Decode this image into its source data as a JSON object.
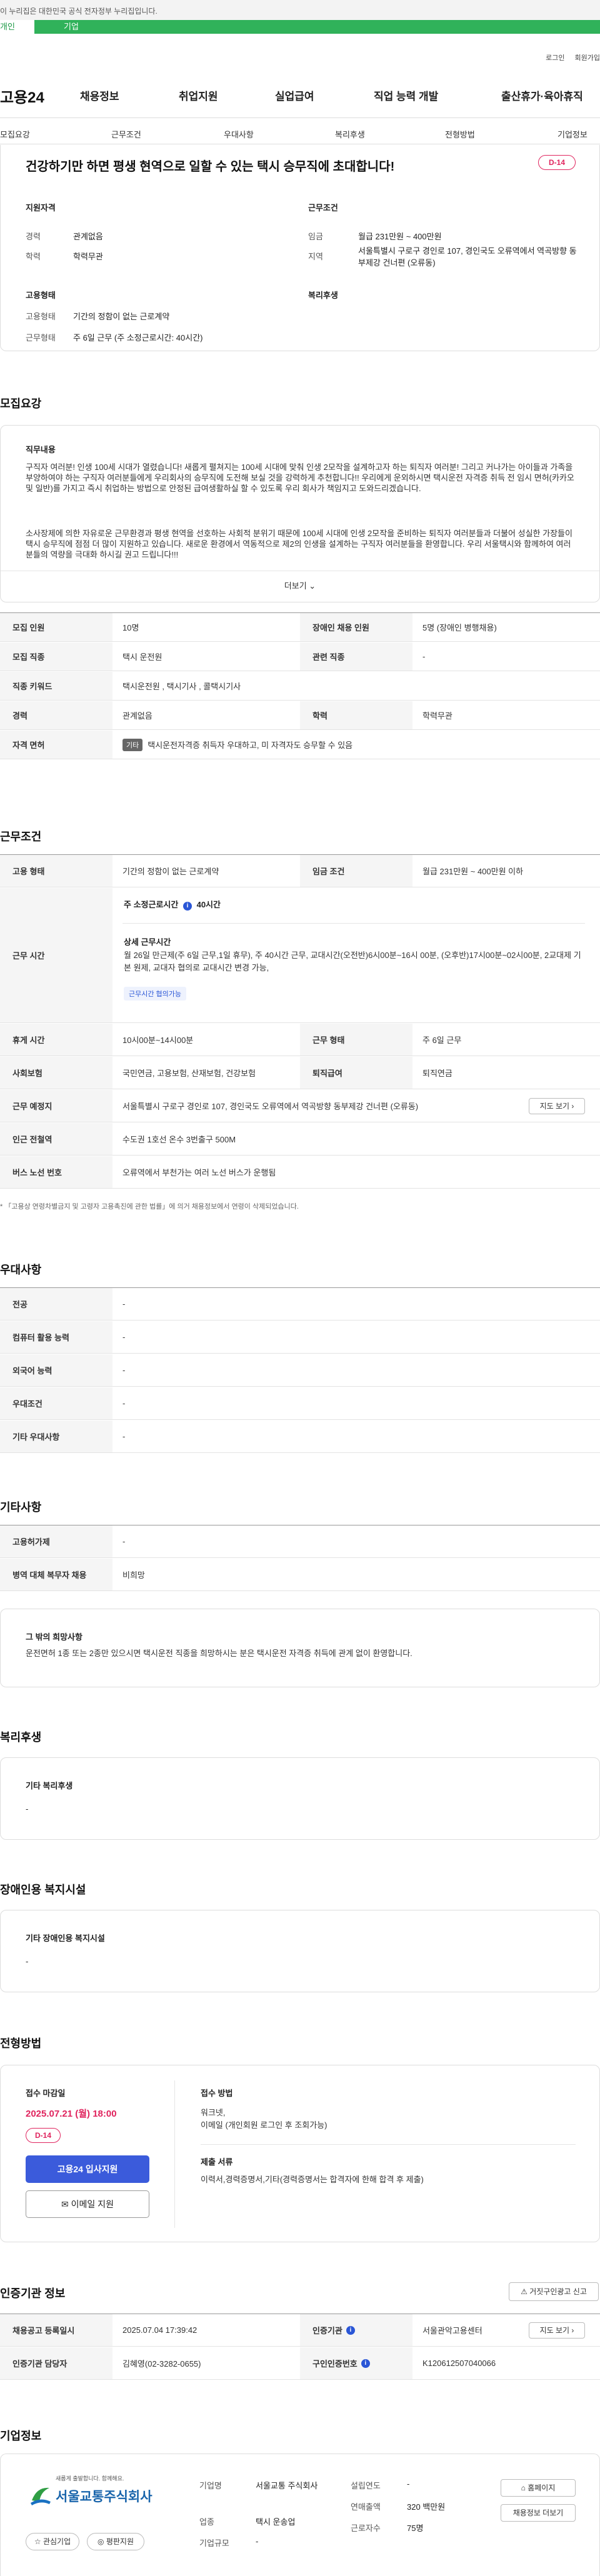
{
  "gov_banner": {
    "text": "이 누리집은 대한민국 공식 전자정부 누리집입니다."
  },
  "portal_tabs": [
    "개인",
    "기업"
  ],
  "util": [
    "로그인",
    "회원가입"
  ],
  "logo": "고용24",
  "gnb": [
    "채용정보",
    "취업지원",
    "실업급여",
    "직업 능력 개발",
    "출산휴가·육아휴직"
  ],
  "subnav": [
    "모집요강",
    "근무조건",
    "우대사항",
    "복리후생",
    "전형방법",
    "기업정보"
  ],
  "summary": {
    "title": "건강하기만 하면 평생 현역으로 일할 수 있는 택시 승무직에 초대합니다!",
    "dday": "D-14",
    "qual_title": "지원자격",
    "career_label": "경력",
    "career": "관계없음",
    "edu_label": "학력",
    "edu": "학력무관",
    "cond_title": "근무조건",
    "wage_label": "임금",
    "wage": "월급 231만원 ~ 400만원",
    "region_label": "지역",
    "region": "서울특별시 구로구 경인로 107, 경인국도 오류역에서 역곡방향 동부제강 건너편 (오류동)",
    "emp_title": "고용형태",
    "emptype_label": "고용형태",
    "emptype": "기간의 정함이 없는 근로계약",
    "worktime_label": "근무형태",
    "worktime": "주 6일 근무 (주 소정근로시간: 40시간)",
    "welfare_title": "복리후생"
  },
  "recruit": {
    "section": "모집요강",
    "duty_title": "직무내용",
    "duty_p1": "구직자 여러분! 인생 100세 시대가 열렸습니다! 새롭게 펼쳐지는 100세 시대에 맞춰 인생 2모작을 설계하고자 하는 퇴직자 여러분! 그리고 커나가는 아이들과 가족을 부양하여야 하는 구직자 여러분들에게 우리회사의 승무직에 도전해 보실 것을 강력하게 추천합니다!! 우리에게 운외하시면 택시운전 자격증 취득 전 임시 면허(카카오 및 일반)를 가지고 즉시 취업하는 방법으로 안정된 급여생활하실 할 수 있도록 우리 회사가 책임지고 도와드리겠습니다.",
    "duty_p2": "소사장제에 의한 자유로운 근무환경과 평생 현역을 선호하는 사회적 분위기 때문에 100세 시대에 인생 2모작을 준비하는 퇴직자 여러분들과 더불어 성실한 가장들이 택시 승무직에 점점 더 많이 지원하고 있습니다. 새로운 환경에서 역동적으로 제2의 인생을 설계하는 구직자 여러분들을 환영합니다.  우리 서울택시와 함께하여 여러분들의 역량을 극대화 하시길 권고 드립니다!!!",
    "more": "더보기",
    "rows": [
      {
        "l1": "모집 인원",
        "v1": "10명",
        "l2": "장애인 채용 인원",
        "v2": "5명 (장애인 병행채용)"
      },
      {
        "l1": "모집 직종",
        "v1": "택시 운전원",
        "l2": "관련 직종",
        "v2": "-"
      },
      {
        "l1": "직종 키워드",
        "v1": "택시운전원 , 택시기사 , 콜택시기사"
      },
      {
        "l1": "경력",
        "v1": "관계없음",
        "l2": "학력",
        "v2": "학력무관"
      },
      {
        "l1": "자격 면허",
        "tag": "기타",
        "v1": "택시운전자격증 취득자 우대하고, 미 자격자도 승무할 수 있음"
      }
    ]
  },
  "workcond": {
    "section": "근무조건",
    "emp_label": "고용 형태",
    "emp": "기간의 정함이 없는 근로계약",
    "wage_label": "임금 조건",
    "wage": "월급 231만원 ~ 400만원 이하",
    "time_label": "근무 시간",
    "weekly": "주 소정근로시간",
    "weekly_hours": "40시간",
    "detail_title": "상세 근무시간",
    "detail": "월 26일 만근제(주 6일 근무,1일 휴무), 주 40시간 근무, 교대시간(오전반)6시00분~16시 00분, (오후반)17시00분~02시00분, 2교대제 기본 원제, 교대자 협의로 교대시간 변경 가능,",
    "detail_tag": "근무시간 협의가능",
    "rest_label": "휴게 시간",
    "rest": "10시00분~14시00분",
    "form_label": "근무 형태",
    "form": "주 6일 근무",
    "ins_label": "사회보험",
    "ins": "국민연금, 고용보험, 산재보험, 건강보험",
    "ret_label": "퇴직급여",
    "ret": "퇴직연금",
    "place_label": "근무 예정지",
    "place": "서울특별시 구로구 경인로 107, 경인국도 오류역에서 역곡방향 동부제강 건너편 (오류동)",
    "map_btn": "지도 보기",
    "subway_label": "인근 전철역",
    "subway": "수도권 1호선 온수 3번출구 500M",
    "bus_label": "버스 노선 번호",
    "bus": "오류역에서 부천가는 여러 노선 버스가 운행됨",
    "note": "「고용상 연령차별금지 및 고령자 고용촉진에 관한 법률」에 의거 채용정보에서 연령이 삭제되었습니다."
  },
  "pref": {
    "section": "우대사항",
    "rows": [
      [
        "전공",
        "-"
      ],
      [
        "컴퓨터 활용 능력",
        "-"
      ],
      [
        "외국어 능력",
        "-"
      ],
      [
        "우대조건",
        "-"
      ],
      [
        "기타 우대사항",
        "-"
      ]
    ]
  },
  "etc": {
    "section": "기타사항",
    "rows": [
      [
        "고용허가제",
        "-"
      ],
      [
        "병역 대체 복무자 채용",
        "비희망"
      ]
    ],
    "other_title": "그 밖의 희망사항",
    "other": "운전면허 1종 또는 2종만 있으시면 택시운전 직종을 희망하시는 분은 택시운전 자격증 취득에 관계 없이 환영합니다."
  },
  "welfare": {
    "section": "복리후생",
    "box_title": "기타 복리후생",
    "box_val": "-"
  },
  "disabled": {
    "section": "장애인용 복지시설",
    "box_title": "기타 장애인용 복지시설",
    "box_val": "-"
  },
  "process": {
    "section": "전형방법",
    "deadline_label": "접수 마감일",
    "deadline": "2025.07.21 (월) 18:00",
    "dday": "D-14",
    "apply_btn": "고용24 입사지원",
    "email_btn": "이메일 지원",
    "method_title": "접수 방법",
    "method": "워크넷,\n이메일 (개인회원 로그인 후 조회가능)",
    "docs_title": "제출 서류",
    "docs": "이력서,경력증명서,기타(경력증명서는 합격자에 한해 합격 후 제출)"
  },
  "cert": {
    "section": "인증기관 정보",
    "report_btn": "거짓구인광고 신고",
    "reg_label": "채용공고 등록일시",
    "reg": "2025.07.04 17:39:42",
    "org_label": "인증기관",
    "org": "서울관악고용센터",
    "map_btn": "지도 보기",
    "mgr_label": "인증기관 담당자",
    "mgr": "김혜영(02-3282-0655)",
    "no_label": "구인인증번호",
    "no": "K120612507040066"
  },
  "company": {
    "section": "기업정보",
    "logo_small": "새롭게 출발합니다. 함께해요.",
    "logo_name": "서울교통주식회사",
    "name_label": "기업명",
    "name": "서울교통 주식회사",
    "year_label": "설립연도",
    "year": "-",
    "industry_label": "업종",
    "industry": "택시 운송업",
    "sales_label": "연매출액",
    "sales": "320 백만원",
    "scale_label": "기업규모",
    "scale": "-",
    "staff_label": "근로자수",
    "staff": "75명",
    "homepage_btn": "홈페이지",
    "jobs_btn": "채용정보 더보기",
    "fav_btn": "관심기업",
    "review_btn": "평판지원"
  }
}
